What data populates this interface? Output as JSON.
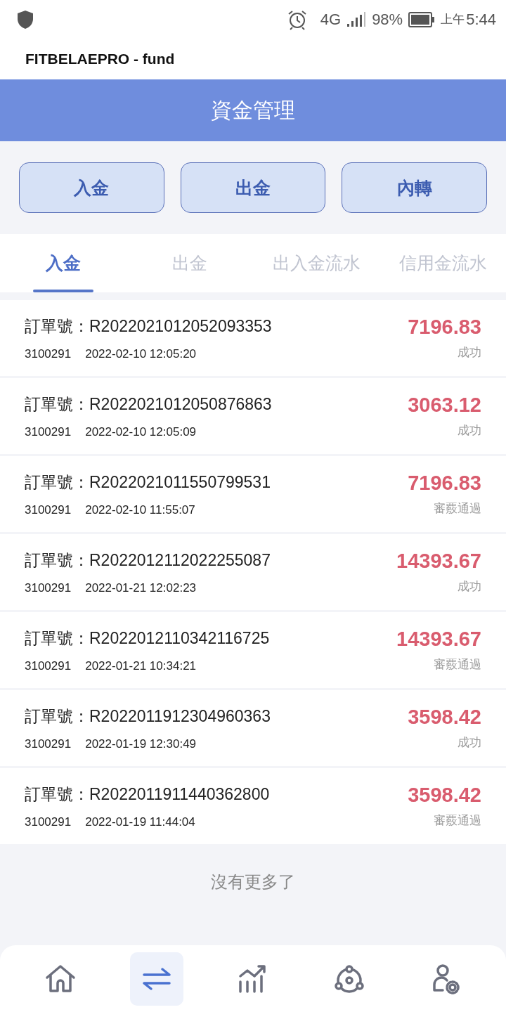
{
  "status_bar": {
    "network": "4G",
    "battery": "98%",
    "time_period": "上午",
    "time": "5:44"
  },
  "app_title": "FITBELAEPRO - fund",
  "header": {
    "title": "資金管理"
  },
  "actions": [
    "入金",
    "出金",
    "內轉"
  ],
  "tabs": [
    {
      "label": "入金",
      "selected": true
    },
    {
      "label": "出金",
      "selected": false
    },
    {
      "label": "出入金流水",
      "selected": false
    },
    {
      "label": "信用金流水",
      "selected": false
    }
  ],
  "records": [
    {
      "order_label": "訂單號：",
      "order_no": "R2022021012052093353",
      "account": "3100291",
      "time": "2022-02-10 12:05:20",
      "amount": "7196.83",
      "status": "成功"
    },
    {
      "order_label": "訂單號：",
      "order_no": "R2022021012050876863",
      "account": "3100291",
      "time": "2022-02-10 12:05:09",
      "amount": "3063.12",
      "status": "成功"
    },
    {
      "order_label": "訂單號：",
      "order_no": "R2022021011550799531",
      "account": "3100291",
      "time": "2022-02-10 11:55:07",
      "amount": "7196.83",
      "status": "審覈通過"
    },
    {
      "order_label": "訂單號：",
      "order_no": "R2022012112022255087",
      "account": "3100291",
      "time": "2022-01-21 12:02:23",
      "amount": "14393.67",
      "status": "成功"
    },
    {
      "order_label": "訂單號：",
      "order_no": "R2022012110342116725",
      "account": "3100291",
      "time": "2022-01-21 10:34:21",
      "amount": "14393.67",
      "status": "審覈通過"
    },
    {
      "order_label": "訂單號：",
      "order_no": "R2022011912304960363",
      "account": "3100291",
      "time": "2022-01-19 12:30:49",
      "amount": "3598.42",
      "status": "成功"
    },
    {
      "order_label": "訂單號：",
      "order_no": "R2022011911440362800",
      "account": "3100291",
      "time": "2022-01-19 11:44:04",
      "amount": "3598.42",
      "status": "審覈通過"
    }
  ],
  "end_message": "沒有更多了",
  "bottom_nav": [
    {
      "kind": "home",
      "selected": false
    },
    {
      "kind": "transfer",
      "selected": true
    },
    {
      "kind": "chart",
      "selected": false
    },
    {
      "kind": "network",
      "selected": false
    },
    {
      "kind": "user-settings",
      "selected": false
    }
  ]
}
